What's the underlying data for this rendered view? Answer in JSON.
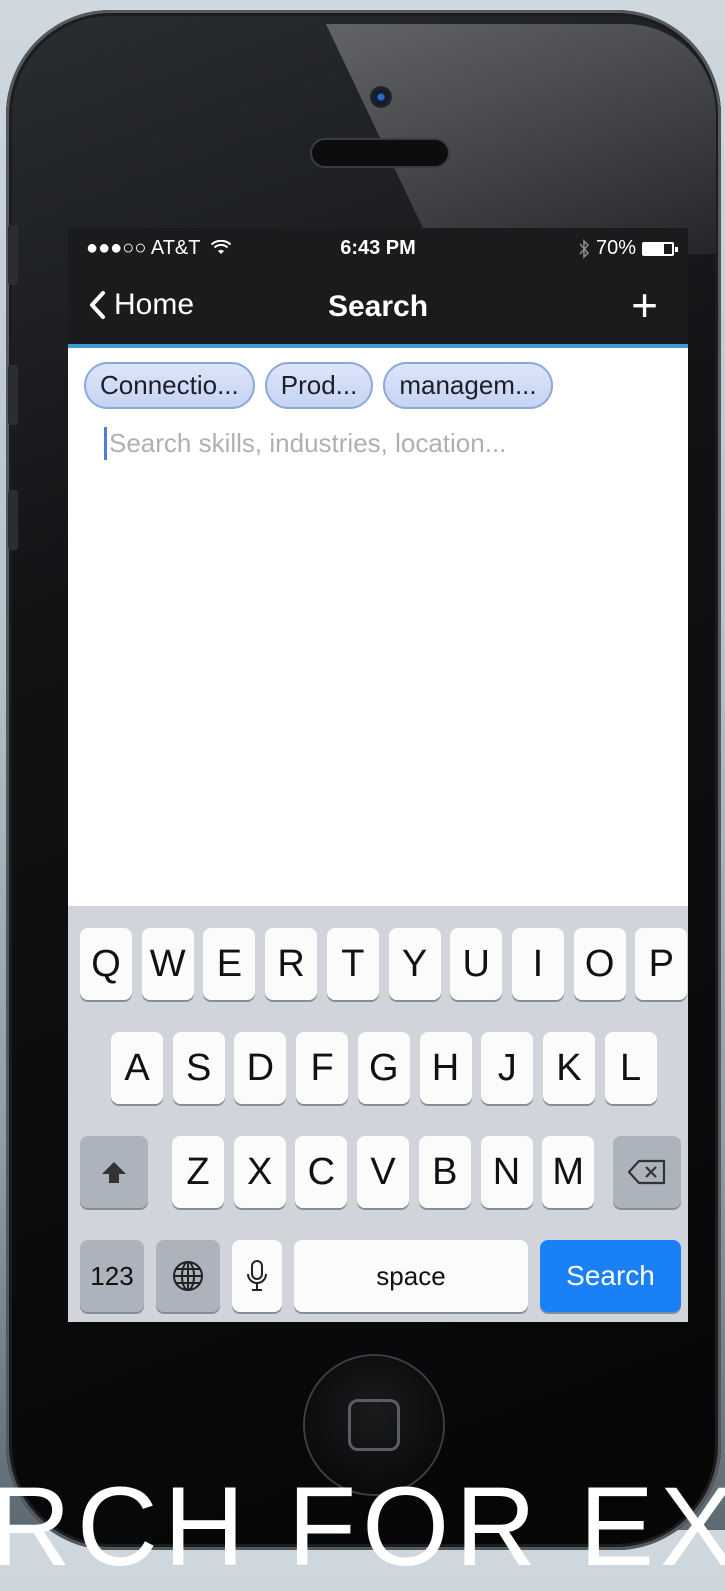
{
  "status_bar": {
    "carrier": "●●●○○ AT&T",
    "time": "6:43 PM",
    "battery_percent": "70%",
    "battery_level": 0.7,
    "icons": [
      "wifi-icon",
      "bluetooth-icon",
      "battery-icon"
    ]
  },
  "nav": {
    "back_label": "Home",
    "title": "Search",
    "add_symbol": "+"
  },
  "chips": [
    {
      "label": "Connectio..."
    },
    {
      "label": "Prod..."
    },
    {
      "label": "managem..."
    }
  ],
  "search": {
    "placeholder": "Search skills, industries, location..."
  },
  "keyboard": {
    "row1": [
      "Q",
      "W",
      "E",
      "R",
      "T",
      "Y",
      "U",
      "I",
      "O",
      "P"
    ],
    "row2": [
      "A",
      "S",
      "D",
      "F",
      "G",
      "H",
      "J",
      "K",
      "L"
    ],
    "row3": [
      "Z",
      "X",
      "C",
      "V",
      "B",
      "N",
      "M"
    ],
    "numbers_label": "123",
    "space_label": "space",
    "search_label": "Search"
  },
  "caption": "RCH FOR EX",
  "colors": {
    "nav_accent": "#3a9bd5",
    "search_key": "#1a80f6",
    "chip_border": "#8da8dd"
  }
}
